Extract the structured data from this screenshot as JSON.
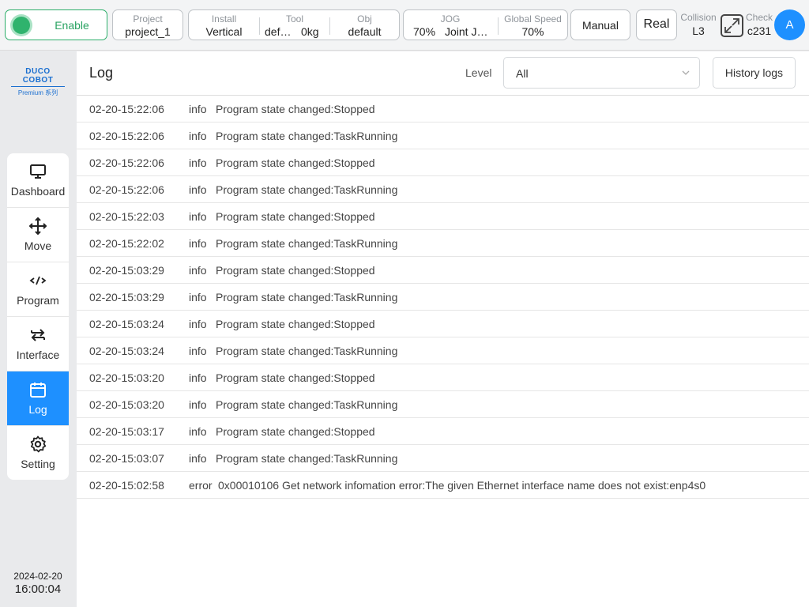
{
  "topbar": {
    "enable_label": "Enable",
    "project": {
      "caption": "Project",
      "value": "project_1"
    },
    "install": {
      "caption": "Install",
      "value": "Vertical"
    },
    "tool": {
      "caption": "Tool",
      "value_name": "def…",
      "value_weight": "0kg"
    },
    "obj": {
      "caption": "Obj",
      "value": "default"
    },
    "jog": {
      "caption": "JOG",
      "value_percent": "70%",
      "value_mode": "Joint J…"
    },
    "global_speed": {
      "caption": "Global Speed",
      "value": "70%"
    },
    "manual_label": "Manual",
    "real_label": "Real",
    "collision": {
      "caption": "Collision",
      "value": "L3"
    },
    "check": {
      "caption": "Check",
      "value": "c231"
    },
    "avatar_letter": "A"
  },
  "sidebar": {
    "logo_brand": "DUCO COBOT",
    "logo_sub": "Premium 系列",
    "items": [
      {
        "label": "Dashboard",
        "icon": "monitor-icon"
      },
      {
        "label": "Move",
        "icon": "move-arrows-icon"
      },
      {
        "label": "Program",
        "icon": "code-icon"
      },
      {
        "label": "Interface",
        "icon": "swap-arrows-icon"
      },
      {
        "label": "Log",
        "icon": "calendar-icon"
      },
      {
        "label": "Setting",
        "icon": "gear-icon"
      }
    ],
    "date": "2024-02-20",
    "time": "16:00:04"
  },
  "main": {
    "title": "Log",
    "level_label": "Level",
    "level_value": "All",
    "history_label": "History logs",
    "logs": [
      {
        "time": "02-20-15:22:06",
        "level": "info",
        "message": "Program state changed:Stopped"
      },
      {
        "time": "02-20-15:22:06",
        "level": "info",
        "message": "Program state changed:TaskRunning"
      },
      {
        "time": "02-20-15:22:06",
        "level": "info",
        "message": "Program state changed:Stopped"
      },
      {
        "time": "02-20-15:22:06",
        "level": "info",
        "message": "Program state changed:TaskRunning"
      },
      {
        "time": "02-20-15:22:03",
        "level": "info",
        "message": "Program state changed:Stopped"
      },
      {
        "time": "02-20-15:22:02",
        "level": "info",
        "message": "Program state changed:TaskRunning"
      },
      {
        "time": "02-20-15:03:29",
        "level": "info",
        "message": "Program state changed:Stopped"
      },
      {
        "time": "02-20-15:03:29",
        "level": "info",
        "message": "Program state changed:TaskRunning"
      },
      {
        "time": "02-20-15:03:24",
        "level": "info",
        "message": "Program state changed:Stopped"
      },
      {
        "time": "02-20-15:03:24",
        "level": "info",
        "message": "Program state changed:TaskRunning"
      },
      {
        "time": "02-20-15:03:20",
        "level": "info",
        "message": "Program state changed:Stopped"
      },
      {
        "time": "02-20-15:03:20",
        "level": "info",
        "message": "Program state changed:TaskRunning"
      },
      {
        "time": "02-20-15:03:17",
        "level": "info",
        "message": "Program state changed:Stopped"
      },
      {
        "time": "02-20-15:03:07",
        "level": "info",
        "message": "Program state changed:TaskRunning"
      },
      {
        "time": "02-20-15:02:58",
        "level": "error",
        "message": "0x00010106 Get network infomation error:The given Ethernet interface name does not exist:enp4s0"
      }
    ]
  }
}
